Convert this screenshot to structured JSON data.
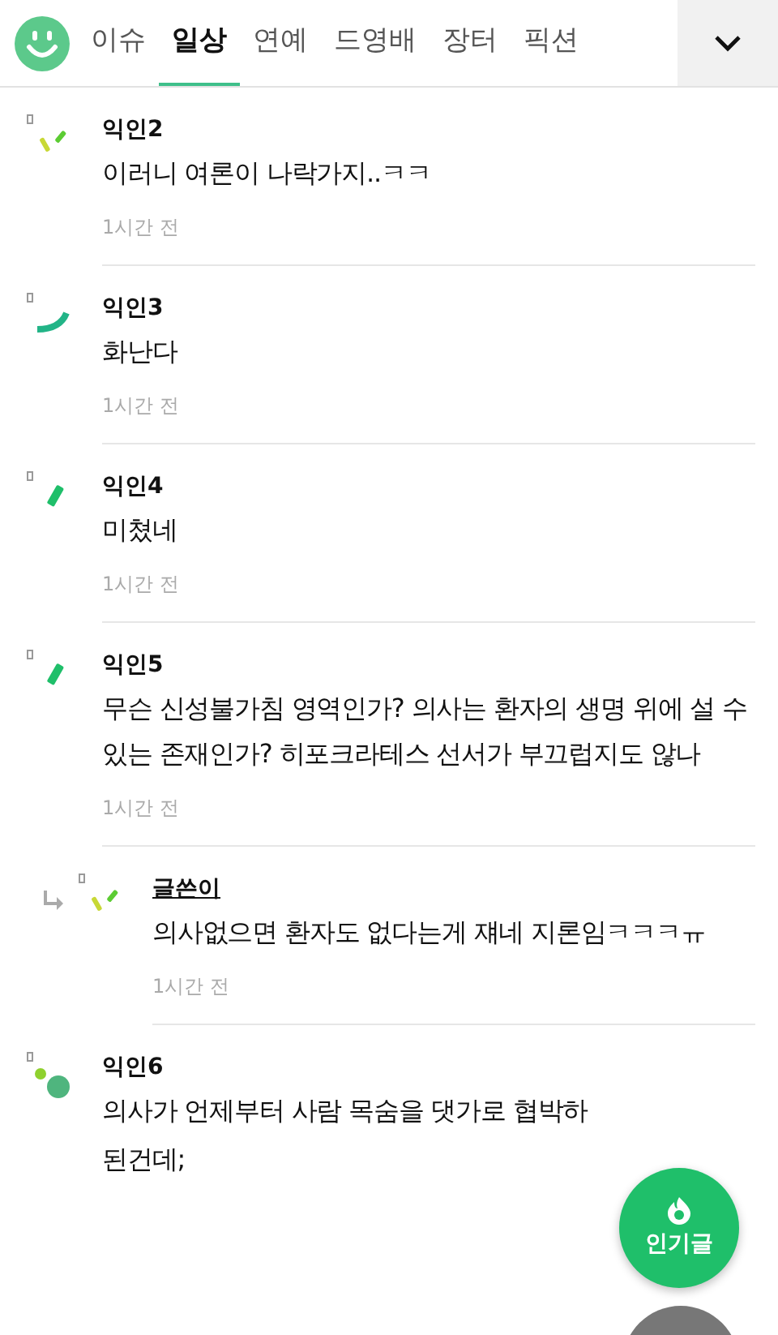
{
  "tabs": [
    {
      "label": "이슈",
      "selected": false
    },
    {
      "label": "일상",
      "selected": true
    },
    {
      "label": "연예",
      "selected": false
    },
    {
      "label": "드영배",
      "selected": false
    },
    {
      "label": "장터",
      "selected": false
    },
    {
      "label": "픽션",
      "selected": false
    }
  ],
  "comments": [
    {
      "kind": "comment",
      "author": "익인2",
      "body": [
        "이러니 여론이 나락가지..ㅋㅋ"
      ],
      "time": "1시간 전"
    },
    {
      "kind": "comment",
      "author": "익인3",
      "body": [
        "화난다"
      ],
      "time": "1시간 전"
    },
    {
      "kind": "comment",
      "author": "익인4",
      "body": [
        "미쳤네"
      ],
      "time": "1시간 전"
    },
    {
      "kind": "comment",
      "author": "익인5",
      "body": [
        "무슨 신성불가침 영역인가? 의사는 환자의 생명 위에 설 수 있는 존재인가? 히포크라테스 선서가 부끄럽지도 않나"
      ],
      "time": "1시간 전"
    },
    {
      "kind": "reply",
      "author": "글쓴이",
      "body": [
        "의사없으면 환자도 없다는게 쟤네 지론임ㅋㅋㅋㅠ"
      ],
      "time": "1시간 전"
    },
    {
      "kind": "comment",
      "author": "익인6",
      "body": [
        "의사가 언제부터 사람 목숨을 댓가로 협박하",
        "된건데;"
      ]
    }
  ],
  "popular_button": {
    "label": "인기글"
  }
}
